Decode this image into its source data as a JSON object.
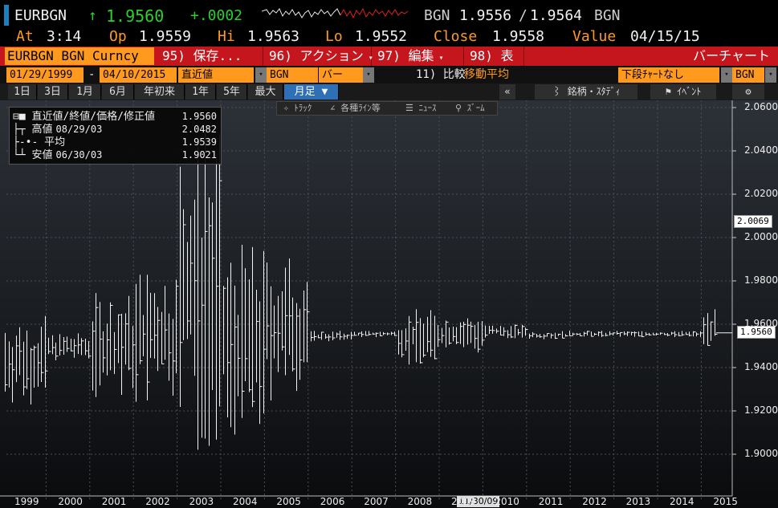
{
  "quote": {
    "ticker": "EURBGN",
    "arrow": "↑",
    "last": "1.9560",
    "change": "+.0002",
    "bid_label": "BGN",
    "bid": "1.9556",
    "slash": "/",
    "ask": "1.9564",
    "ask_label": "BGN",
    "at_label": "At",
    "at_value": "3:14",
    "open_label": "Op",
    "open_value": "1.9559",
    "high_label": "Hi",
    "high_value": "1.9563",
    "low_label": "Lo",
    "low_value": "1.9552",
    "close_label": "Close",
    "close_value": "1.9558",
    "value_label": "Value",
    "value_date": "04/15/15"
  },
  "menubar": {
    "security": "EURBGN BGN Curncy",
    "save": "95) 保存...",
    "action": "96) アクション",
    "edit": "97) 編集",
    "table": "98) 表",
    "chart_type": "バーチャート",
    "dd": "▾"
  },
  "settings": {
    "start_date": "01/29/1999",
    "dash": "-",
    "end_date": "04/10/2015",
    "price_mode": "直近値",
    "currency": "BGN",
    "bar_type": "バー",
    "compare": "11) 比較",
    "moving_avg": "移動平均",
    "lower_chart": "下段ﾁｬｰﾄなし",
    "currency2": "BGN",
    "dd": "▾"
  },
  "periods": [
    "1日",
    "3日",
    "1月",
    "6月",
    "年初来",
    "1年",
    "5年",
    "最大"
  ],
  "period_active": "月足 ▼",
  "right_tools": {
    "collapse": "«",
    "studies": "銘柄・ｽﾀﾃﾞｨ",
    "events": "ｲﾍﾞﾝﾄ",
    "gear": "⚙"
  },
  "chart_tools": {
    "track": "✧ ﾄﾗｯｸ",
    "lines": "∠ 各種ﾗｲﾝ等",
    "news": "☰ ﾆｭｰｽ",
    "zoom": "⚲ ｽﾞｰﾑ"
  },
  "legend": {
    "series": {
      "label": "直近値/終値/価格/修正値",
      "value": "1.9560"
    },
    "high": {
      "label": "高値",
      "date": "08/29/03",
      "value": "2.0482"
    },
    "avg": {
      "label": "平均",
      "value": "1.9539"
    },
    "low": {
      "label": "安値",
      "date": "06/30/03",
      "value": "1.9021"
    }
  },
  "tags": {
    "ma_value": "2.0069",
    "last_value": "1.9560"
  },
  "cursor_date": "11/30/09",
  "colors": {
    "accent_orange": "#ff9a1f",
    "menu_red": "#c4161c",
    "up_green": "#2bd12b",
    "select_blue": "#2f6fb5"
  },
  "chart_data": {
    "type": "bar",
    "subtype": "ohlc-monthly",
    "y_ticks": [
      "2.0600",
      "2.0400",
      "2.0200",
      "2.0000",
      "1.9800",
      "1.9600",
      "1.9400",
      "1.9200",
      "1.9000"
    ],
    "ylim": [
      1.888,
      2.064
    ],
    "x_ticks": [
      "1999",
      "2000",
      "2001",
      "2002",
      "2003",
      "2004",
      "2005",
      "2006",
      "2007",
      "2008",
      "2009",
      "2010",
      "2011",
      "2012",
      "2013",
      "2014",
      "2015"
    ],
    "grid": true,
    "legend_position": "top-left",
    "high_point": {
      "date": "08/29/03",
      "value": 2.0482
    },
    "low_point": {
      "date": "06/30/03",
      "value": 1.9021
    },
    "average": 1.9539,
    "last": 1.956,
    "yearly_ranges": [
      {
        "year": "1999",
        "low": 1.922,
        "high": 1.964
      },
      {
        "year": "2000",
        "low": 1.943,
        "high": 1.956
      },
      {
        "year": "2001",
        "low": 1.925,
        "high": 1.975
      },
      {
        "year": "2002",
        "low": 1.921,
        "high": 1.987
      },
      {
        "year": "2003",
        "low": 1.9021,
        "high": 2.0482
      },
      {
        "year": "2004",
        "low": 1.905,
        "high": 1.997
      },
      {
        "year": "2005",
        "low": 1.922,
        "high": 1.993
      },
      {
        "year": "2006",
        "low": 1.952,
        "high": 1.957
      },
      {
        "year": "2007",
        "low": 1.954,
        "high": 1.957
      },
      {
        "year": "2008",
        "low": 1.941,
        "high": 1.967
      },
      {
        "year": "2009",
        "low": 1.946,
        "high": 1.965
      },
      {
        "year": "2010",
        "low": 1.953,
        "high": 1.96
      },
      {
        "year": "2011",
        "low": 1.953,
        "high": 1.957
      },
      {
        "year": "2012",
        "low": 1.954,
        "high": 1.957
      },
      {
        "year": "2013",
        "low": 1.954,
        "high": 1.957
      },
      {
        "year": "2014",
        "low": 1.954,
        "high": 1.957
      },
      {
        "year": "2015",
        "low": 1.95,
        "high": 1.967
      }
    ]
  }
}
